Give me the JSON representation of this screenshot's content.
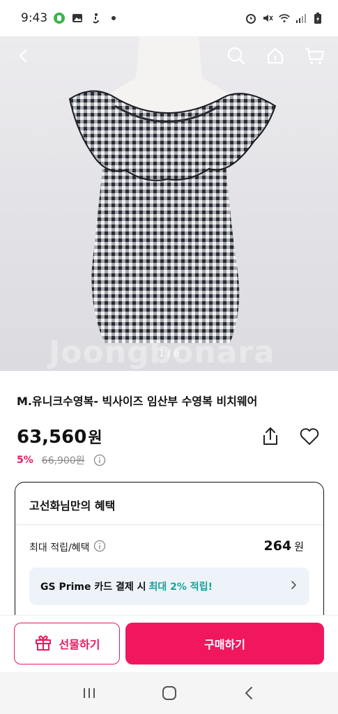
{
  "status_bar": {
    "time": "9:43",
    "icons": [
      "line-app-icon",
      "gallery-icon",
      "accessibility-icon",
      "dot-icon",
      "alarm-icon",
      "mute-icon",
      "wifi-icon",
      "signal-icon",
      "battery-icon"
    ]
  },
  "hero": {
    "watermark": "Joongbonara",
    "page_indicator": "1 / 6",
    "nav_icons": [
      "back-icon",
      "search-icon",
      "home-icon",
      "cart-icon"
    ]
  },
  "product": {
    "title": "M.유니크수영복- 빅사이즈 임산부 수영복 비치웨어",
    "price": "63,560",
    "price_unit": "원",
    "discount_percent": "5%",
    "original_price": "66,900원"
  },
  "benefits": {
    "title": "고선화님만의 혜택",
    "reward_label": "최대 적립/혜택",
    "reward_value": "264",
    "reward_unit": "원",
    "promo_text": "GS Prime 카드 결제 시",
    "promo_highlight": "최대 2% 적립!"
  },
  "actions": {
    "gift_label": "선물하기",
    "buy_label": "구매하기"
  },
  "colors": {
    "accent": "#f0175f",
    "promo_highlight": "#16a39a",
    "promo_bg": "#eef3fa"
  }
}
